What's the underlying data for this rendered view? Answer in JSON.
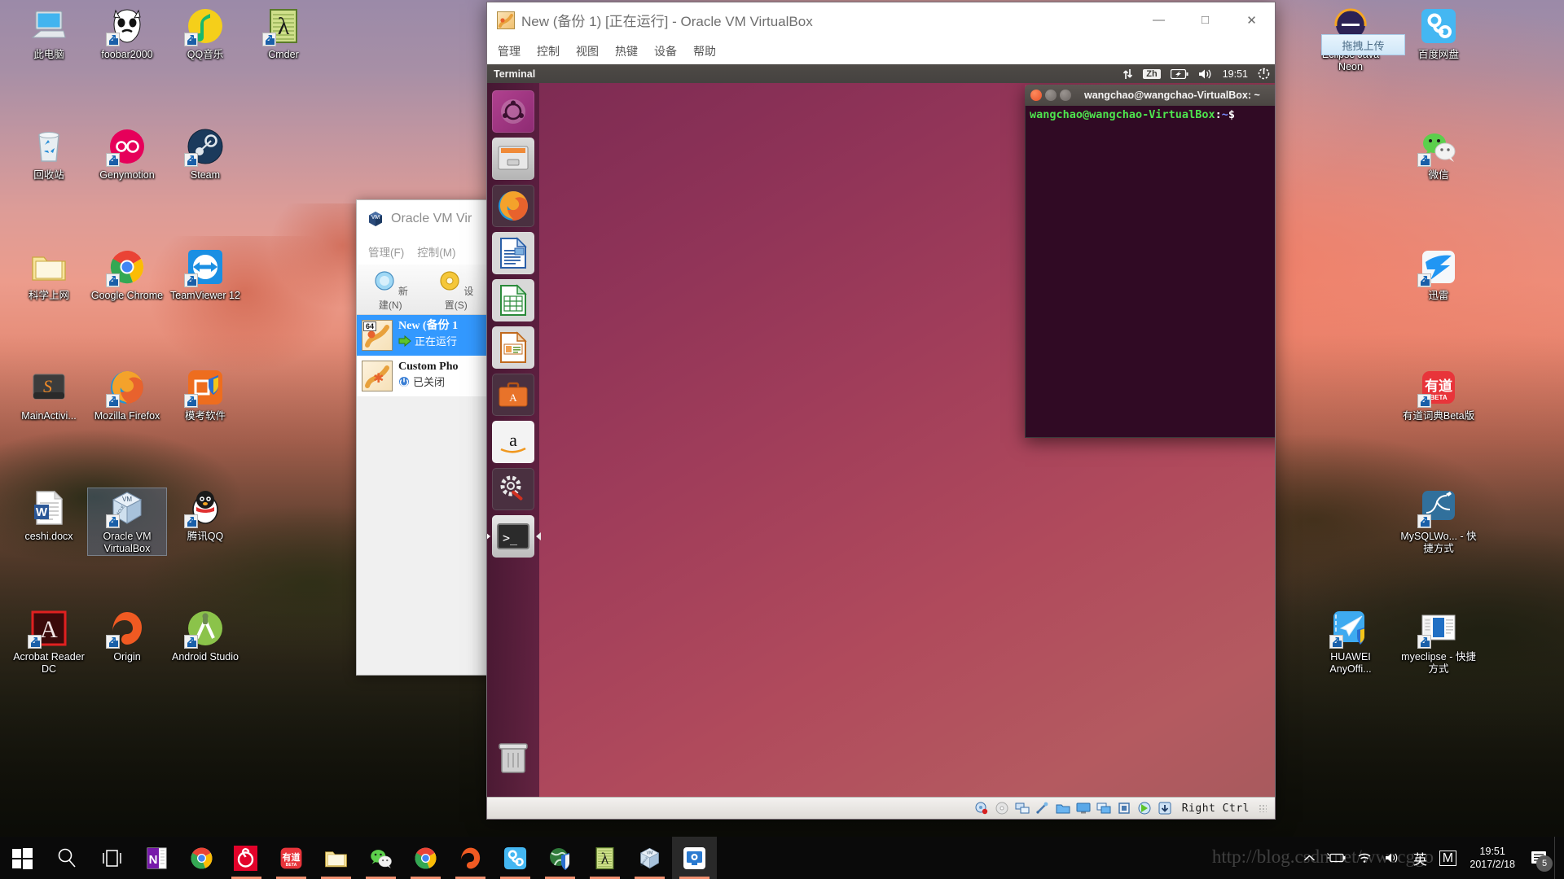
{
  "desktop": {
    "icons_left": [
      {
        "label": "此电脑",
        "icon": "this-pc-icon",
        "shortcut": false,
        "col": 0,
        "row": 0
      },
      {
        "label": "foobar2000",
        "icon": "foobar2000-icon",
        "shortcut": true,
        "col": 1,
        "row": 0
      },
      {
        "label": "QQ音乐",
        "icon": "qq-music-icon",
        "shortcut": true,
        "col": 2,
        "row": 0
      },
      {
        "label": "Cmder",
        "icon": "cmder-icon",
        "shortcut": true,
        "col": 3,
        "row": 0
      },
      {
        "label": "回收站",
        "icon": "recycle-bin-icon",
        "shortcut": false,
        "col": 0,
        "row": 1
      },
      {
        "label": "Genymotion",
        "icon": "genymotion-icon",
        "shortcut": true,
        "col": 1,
        "row": 1
      },
      {
        "label": "Steam",
        "icon": "steam-icon",
        "shortcut": true,
        "col": 2,
        "row": 1
      },
      {
        "label": "科学上网",
        "icon": "folder-icon",
        "shortcut": false,
        "col": 0,
        "row": 2
      },
      {
        "label": "Google Chrome",
        "icon": "chrome-icon",
        "shortcut": true,
        "col": 1,
        "row": 2
      },
      {
        "label": "TeamViewer 12",
        "icon": "teamviewer-icon",
        "shortcut": true,
        "col": 2,
        "row": 2
      },
      {
        "label": "MainActivi...",
        "icon": "sublime-icon",
        "shortcut": false,
        "col": 0,
        "row": 3
      },
      {
        "label": "Mozilla Firefox",
        "icon": "firefox-icon",
        "shortcut": true,
        "col": 1,
        "row": 3
      },
      {
        "label": "模考软件",
        "icon": "exam-software-icon",
        "shortcut": true,
        "col": 2,
        "row": 3
      },
      {
        "label": "ceshi.docx",
        "icon": "word-doc-icon",
        "shortcut": false,
        "col": 0,
        "row": 4
      },
      {
        "label": "Oracle VM VirtualBox",
        "icon": "virtualbox-icon",
        "shortcut": true,
        "selected": true,
        "col": 1,
        "row": 4
      },
      {
        "label": "腾讯QQ",
        "icon": "tencent-qq-icon",
        "shortcut": true,
        "col": 2,
        "row": 4
      },
      {
        "label": "Acrobat Reader DC",
        "icon": "acrobat-icon",
        "shortcut": true,
        "col": 0,
        "row": 5
      },
      {
        "label": "Origin",
        "icon": "origin-icon",
        "shortcut": true,
        "col": 1,
        "row": 5
      },
      {
        "label": "Android Studio",
        "icon": "android-studio-icon",
        "shortcut": true,
        "col": 2,
        "row": 5
      }
    ],
    "icons_right": [
      {
        "label": "Eclipse Java Neon",
        "icon": "eclipse-icon",
        "shortcut": false,
        "col": 0,
        "row": 0
      },
      {
        "label": "百度网盘",
        "icon": "baidu-netdisk-icon",
        "shortcut": false,
        "col": 1,
        "row": 0
      },
      {
        "label": "微信",
        "icon": "wechat-icon",
        "shortcut": true,
        "col": 1,
        "row": 1
      },
      {
        "label": "迅雷",
        "icon": "thunder-icon",
        "shortcut": true,
        "col": 1,
        "row": 2
      },
      {
        "label": "有道词典Beta版",
        "icon": "youdao-dict-icon",
        "shortcut": true,
        "col": 1,
        "row": 3
      },
      {
        "label": "MySQLWo... - 快捷方式",
        "icon": "mysql-workbench-icon",
        "shortcut": true,
        "col": 1,
        "row": 4
      },
      {
        "label": "HUAWEI AnyOffi...",
        "icon": "huawei-anyoffice-icon",
        "shortcut": true,
        "col": 0,
        "row": 5
      },
      {
        "label": "myeclipse - 快捷方式",
        "icon": "myeclipse-icon",
        "shortcut": true,
        "col": 1,
        "row": 5
      }
    ],
    "baidu_tooltip": "拖拽上传"
  },
  "vbox_manager": {
    "title": "Oracle VM Vir",
    "menus": [
      "管理(F)",
      "控制(M)"
    ],
    "toolbar": [
      {
        "label": "新建(N)",
        "icon": "new-vm-icon"
      },
      {
        "label": "设置(S)",
        "icon": "settings-gear-icon"
      }
    ],
    "vms": [
      {
        "name": "New (备份 1",
        "state": "正在运行",
        "arch": "64",
        "active": true
      },
      {
        "name": "Custom Pho",
        "state": "已关闭",
        "arch": "",
        "active": false
      }
    ]
  },
  "vm_window": {
    "title": "New (备份 1) [正在运行] - Oracle VM VirtualBox",
    "menus": [
      "管理",
      "控制",
      "视图",
      "热键",
      "设备",
      "帮助"
    ],
    "window_buttons": {
      "minimize": "—",
      "maximize": "□",
      "close": "✕"
    },
    "status_bar": {
      "right_ctrl": "Right Ctrl",
      "icons": [
        "hard-disk-icon",
        "optical-disk-icon",
        "network-icon",
        "usb-icon",
        "shared-folder-icon",
        "display-icon",
        "remote-display-icon",
        "cpu-icon",
        "guest-additions-icon",
        "capture-icon"
      ]
    }
  },
  "ubuntu": {
    "panel": {
      "window_title": "Terminal",
      "indicators": [
        {
          "name": "network-icon",
          "value": "⇅"
        },
        {
          "name": "keyboard-layout-indicator",
          "value": "Zh"
        },
        {
          "name": "battery-icon",
          "value": ""
        },
        {
          "name": "volume-icon",
          "value": ""
        }
      ],
      "clock": "19:51",
      "session_icon": "power-gear-icon"
    },
    "launcher": [
      {
        "name": "ubuntu-dash-icon",
        "label": "Dash",
        "active": false
      },
      {
        "name": "files-icon",
        "label": "Files",
        "active": false
      },
      {
        "name": "firefox-icon",
        "label": "Firefox",
        "active": false
      },
      {
        "name": "libreoffice-writer-icon",
        "label": "LibreOffice Writer",
        "active": false
      },
      {
        "name": "libreoffice-calc-icon",
        "label": "LibreOffice Calc",
        "active": false
      },
      {
        "name": "libreoffice-impress-icon",
        "label": "LibreOffice Impress",
        "active": false
      },
      {
        "name": "ubuntu-software-icon",
        "label": "Ubuntu Software",
        "active": false
      },
      {
        "name": "amazon-icon",
        "label": "Amazon",
        "active": false
      },
      {
        "name": "system-settings-icon",
        "label": "System Settings",
        "active": false
      },
      {
        "name": "terminal-icon",
        "label": "Terminal",
        "active": true
      }
    ],
    "trash": {
      "name": "trash-icon",
      "label": "Trash"
    },
    "terminal": {
      "title": "wangchao@wangchao-VirtualBox: ~",
      "prompt_user": "wangchao@wangchao-VirtualBox",
      "prompt_sep": ":",
      "prompt_path": "~",
      "prompt_symbol": "$"
    }
  },
  "taskbar": {
    "items": [
      {
        "name": "start-button",
        "icon": "windows-logo-icon",
        "running": false
      },
      {
        "name": "search-button",
        "icon": "search-icon",
        "running": false
      },
      {
        "name": "task-view-button",
        "icon": "task-view-icon",
        "running": false
      },
      {
        "name": "taskbar-onenote",
        "icon": "onenote-icon",
        "running": false
      },
      {
        "name": "taskbar-chrome",
        "icon": "chrome-icon",
        "running": false
      },
      {
        "name": "taskbar-netease-music",
        "icon": "netease-music-icon",
        "running": true
      },
      {
        "name": "taskbar-youdao",
        "icon": "youdao-dict-icon",
        "running": true
      },
      {
        "name": "taskbar-file-explorer",
        "icon": "folder-icon",
        "running": true
      },
      {
        "name": "taskbar-wechat",
        "icon": "wechat-icon",
        "running": true
      },
      {
        "name": "taskbar-chrome-2",
        "icon": "chrome-icon",
        "running": true
      },
      {
        "name": "taskbar-origin",
        "icon": "origin-icon",
        "running": true
      },
      {
        "name": "taskbar-baidu-netdisk",
        "icon": "baidu-netdisk-icon",
        "running": true
      },
      {
        "name": "taskbar-security",
        "icon": "security-globe-icon",
        "running": true
      },
      {
        "name": "taskbar-cmder",
        "icon": "cmder-icon",
        "running": true
      },
      {
        "name": "taskbar-virtualbox",
        "icon": "virtualbox-icon",
        "running": true
      },
      {
        "name": "taskbar-vm-window",
        "icon": "vm-display-icon",
        "running": true,
        "current": true
      }
    ],
    "tray": [
      {
        "name": "show-hidden-icons",
        "glyph": "∧"
      },
      {
        "name": "battery-icon",
        "glyph": ""
      },
      {
        "name": "wifi-icon",
        "glyph": ""
      },
      {
        "name": "volume-icon",
        "glyph": ""
      },
      {
        "name": "ime-indicator",
        "glyph": "英"
      },
      {
        "name": "ime-mode-icon",
        "glyph": "M"
      }
    ],
    "clock": {
      "time": "19:51",
      "date": "2017/2/18"
    },
    "notifications": {
      "name": "action-center",
      "count": "5"
    }
  },
  "watermark": "http://blog.csdn.net/wwccggo"
}
